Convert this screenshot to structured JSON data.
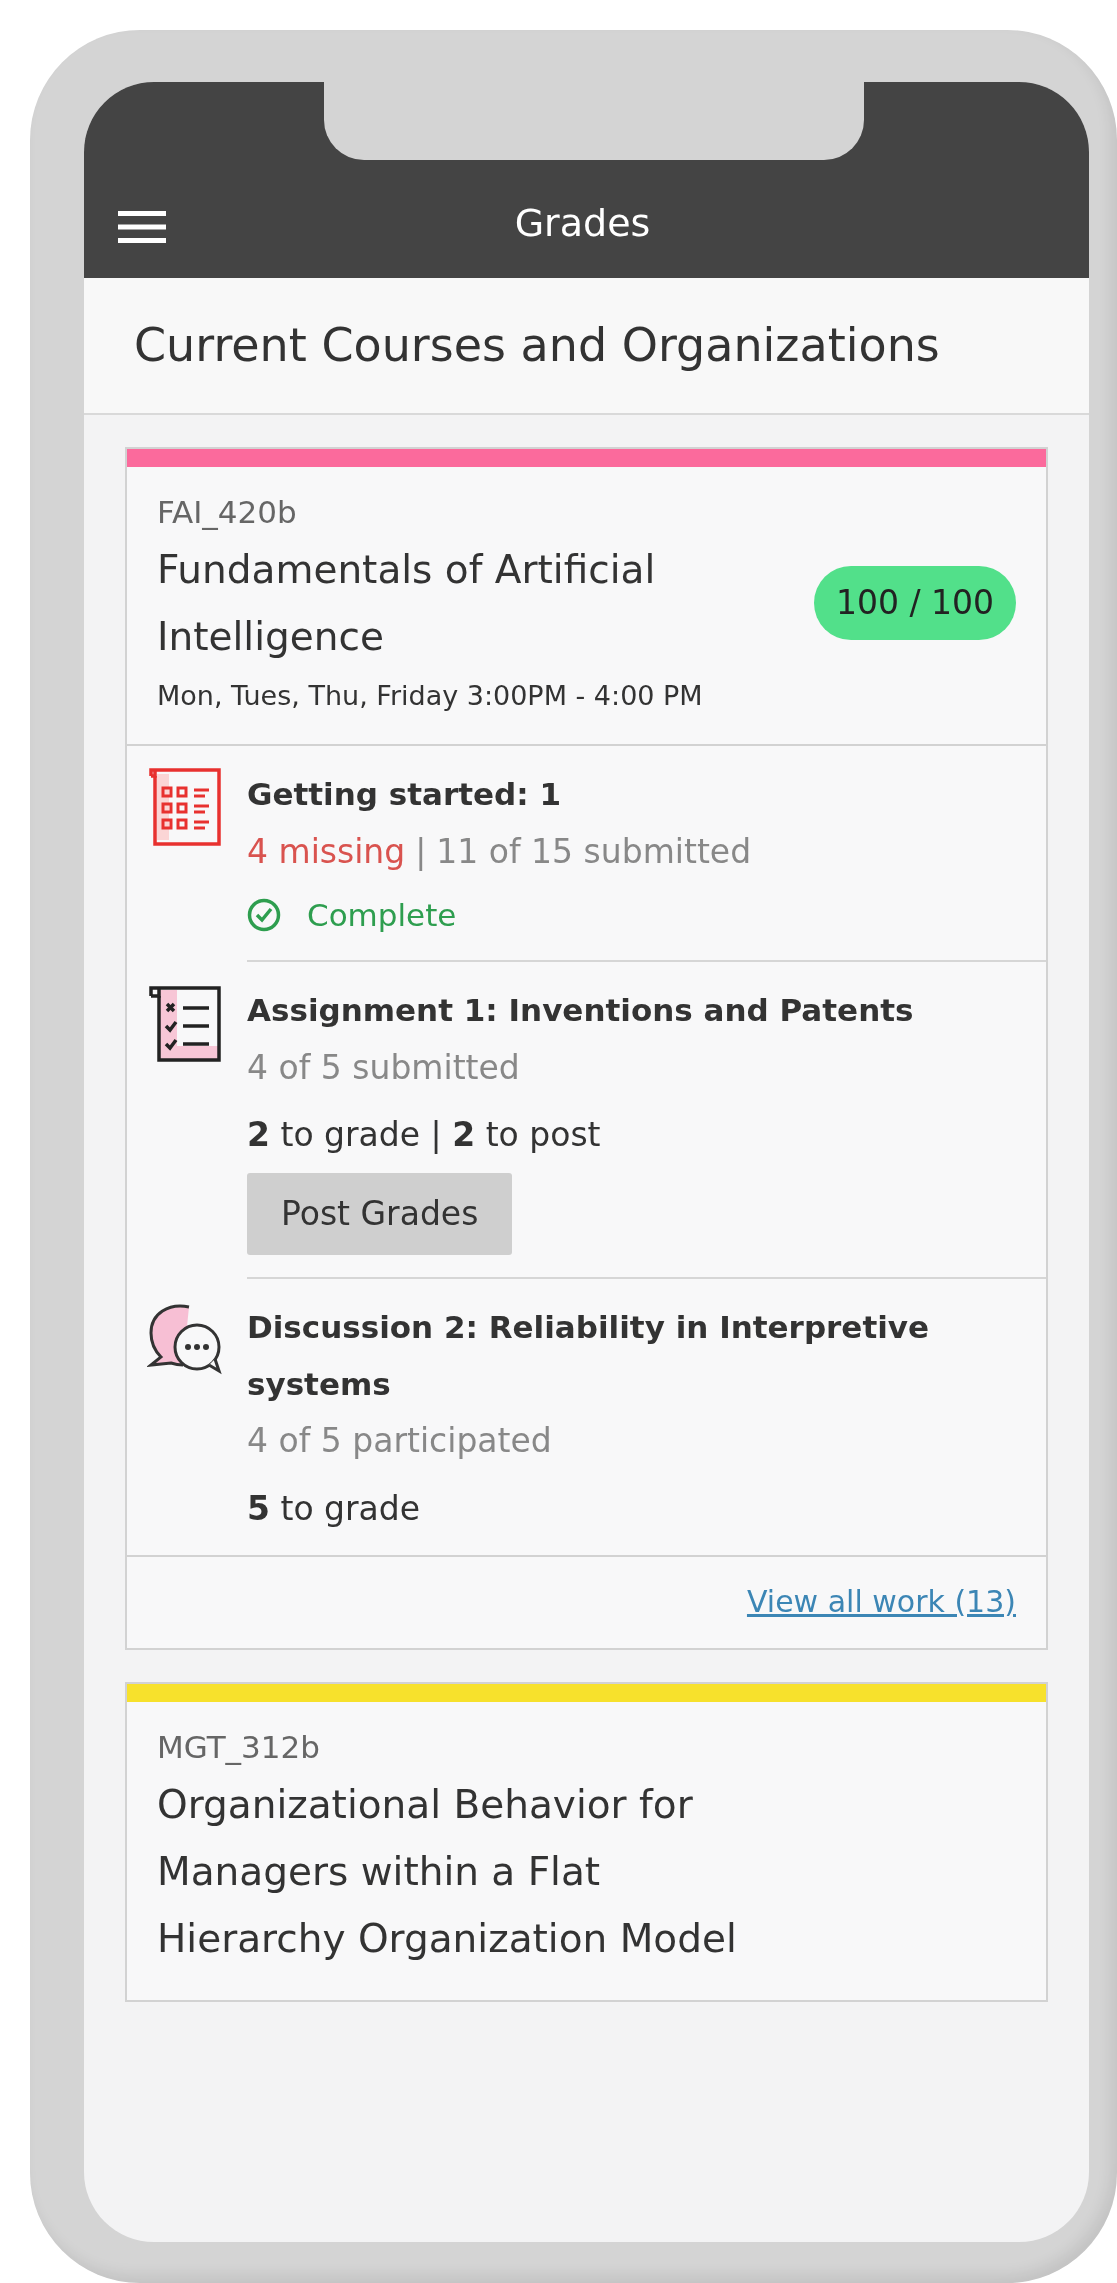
{
  "header": {
    "title": "Grades"
  },
  "heading": "Current Courses and Organizations",
  "courses": [
    {
      "code": "FAI_420b",
      "title": "Fundamentals of Artificial Intelligence",
      "schedule": "Mon, Tues, Thu, Friday 3:00PM - 4:00 PM",
      "color": "#fb6a9c",
      "grade": "100 / 100",
      "items": [
        {
          "kind": "test",
          "title": "Getting started: 1",
          "missing": "4 missing",
          "separator": "|",
          "submitted": "11 of 15 submitted",
          "status": "Complete"
        },
        {
          "kind": "assignment",
          "title": "Assignment 1: Inventions and Patents",
          "submitted": "4 of 5 submitted",
          "to_grade": "**2** to grade | **2** to post",
          "button": "Post Grades"
        },
        {
          "kind": "discussion",
          "title": "Discussion 2: Reliability in Interpretive systems",
          "submitted": "4 of 5 participated",
          "to_grade": "**5** to grade"
        }
      ],
      "link": "View all work (13)"
    },
    {
      "code": "MGT_312b",
      "title": "Organizational Behavior for Managers within a Flat Hierarchy Organization Model",
      "color": "#f7e12c"
    }
  ]
}
